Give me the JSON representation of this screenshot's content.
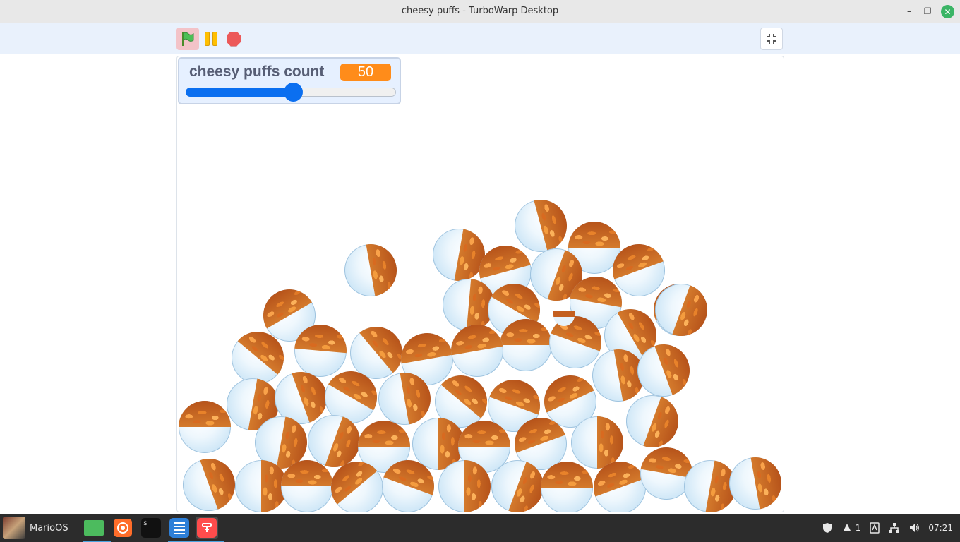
{
  "window": {
    "title": "cheesy puffs - TurboWarp Desktop",
    "minimize_glyph": "–",
    "maximize_glyph": "❐",
    "close_glyph": "✕"
  },
  "toolbar": {
    "green_flag_icon": "green-flag-icon",
    "pause_icon": "pause-icon",
    "stop_icon": "stop-icon",
    "fullscreen_icon": "exit-fullscreen-icon"
  },
  "monitor": {
    "label": "cheesy puffs count",
    "value": "50",
    "slider_fraction": 0.51
  },
  "taskbar": {
    "menu_label": "MarioOS",
    "apps": [
      "folder-icon",
      "firefox-icon",
      "terminal-icon",
      "text-editor-icon",
      "turbowarp-icon"
    ],
    "terminal_glyph": "$_",
    "tray": {
      "notification_count": "1",
      "clock": "07:21"
    }
  },
  "colors": {
    "monitor_value_bg": "#ff8c1a",
    "slider_fill": "#0b6ff0",
    "flag_button_active": "#f3c3c8"
  }
}
